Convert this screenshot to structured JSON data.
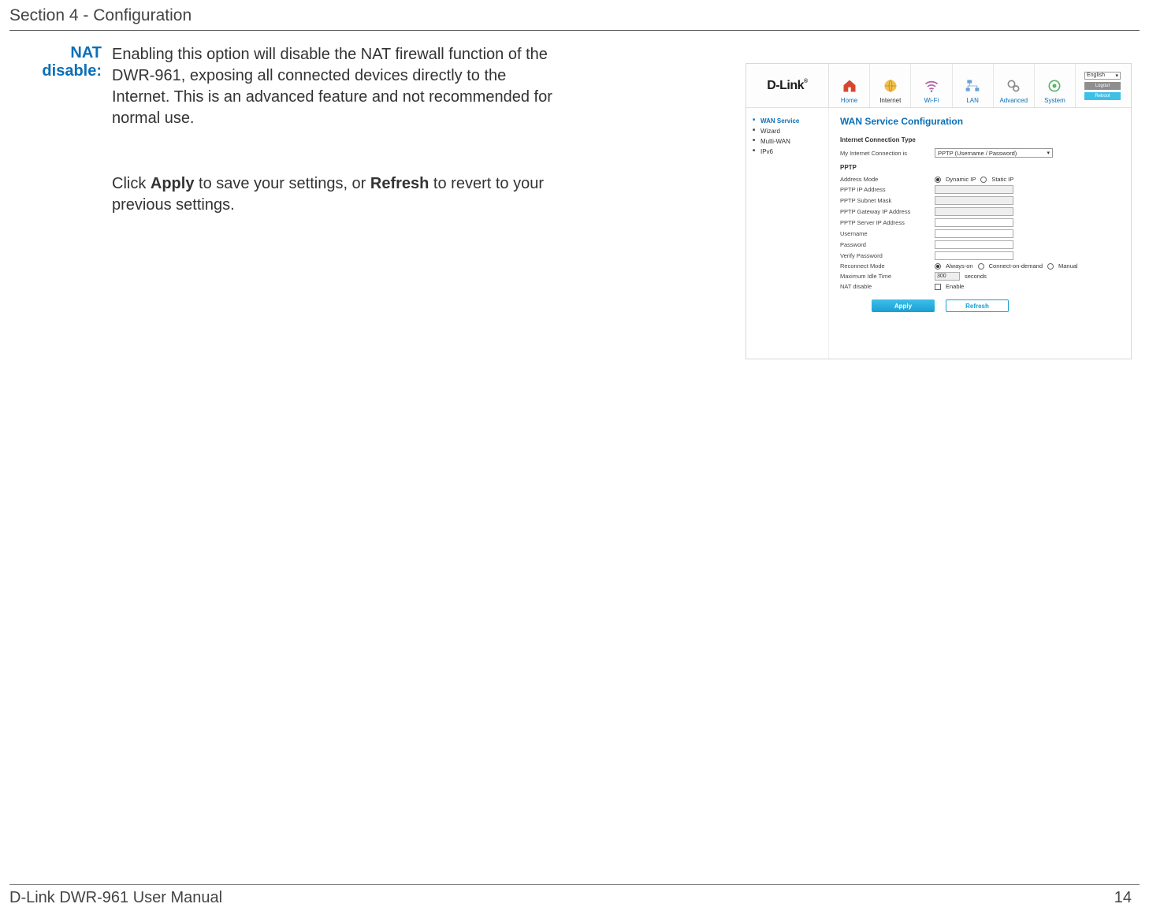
{
  "page": {
    "section_header": "Section 4 - Configuration",
    "footer_left": "D-Link DWR-961 User Manual",
    "footer_page": "14"
  },
  "content": {
    "field_label": "NAT disable:",
    "field_desc": "Enabling this option will disable the NAT firewall function of the DWR-961, exposing all connected devices directly to the Internet. This is an advanced feature and not recommended for normal use.",
    "apply_pre": "Click ",
    "apply_b1": "Apply",
    "apply_mid": " to save your settings, or ",
    "apply_b2": "Refresh",
    "apply_post": " to revert to your previous settings."
  },
  "shot": {
    "logo": "D-Link",
    "nav": [
      "Home",
      "Internet",
      "Wi-Fi",
      "LAN",
      "Advanced",
      "System"
    ],
    "nav_active": "Internet",
    "lang": "English",
    "top_buttons": {
      "logout": "Logout",
      "reboot": "Reboot"
    },
    "sidebar": [
      "WAN Service",
      "Wizard",
      "Multi-WAN",
      "IPv6"
    ],
    "sidebar_active": "WAN Service",
    "title": "WAN Service Configuration",
    "sect1": "Internet Connection Type",
    "conn_label": "My Internet Connection is",
    "conn_value": "PPTP (Username / Password)",
    "sect2": "PPTP",
    "rows": {
      "address_mode": "Address Mode",
      "dynamic_ip": "Dynamic IP",
      "static_ip": "Static IP",
      "pptp_ip": "PPTP IP Address",
      "pptp_subnet": "PPTP Subnet Mask",
      "pptp_gateway": "PPTP Gateway IP Address",
      "pptp_server": "PPTP Server IP Address",
      "username": "Username",
      "password": "Password",
      "verify_pw": "Verify Password",
      "reconnect": "Reconnect Mode",
      "always_on": "Always-on",
      "connect_demand": "Connect-on-demand",
      "manual": "Manual",
      "max_idle": "Maximum Idle Time",
      "max_idle_value": "300",
      "seconds": "seconds",
      "nat_disable": "NAT disable",
      "enable": "Enable"
    },
    "buttons": {
      "apply": "Apply",
      "refresh": "Refresh"
    }
  }
}
